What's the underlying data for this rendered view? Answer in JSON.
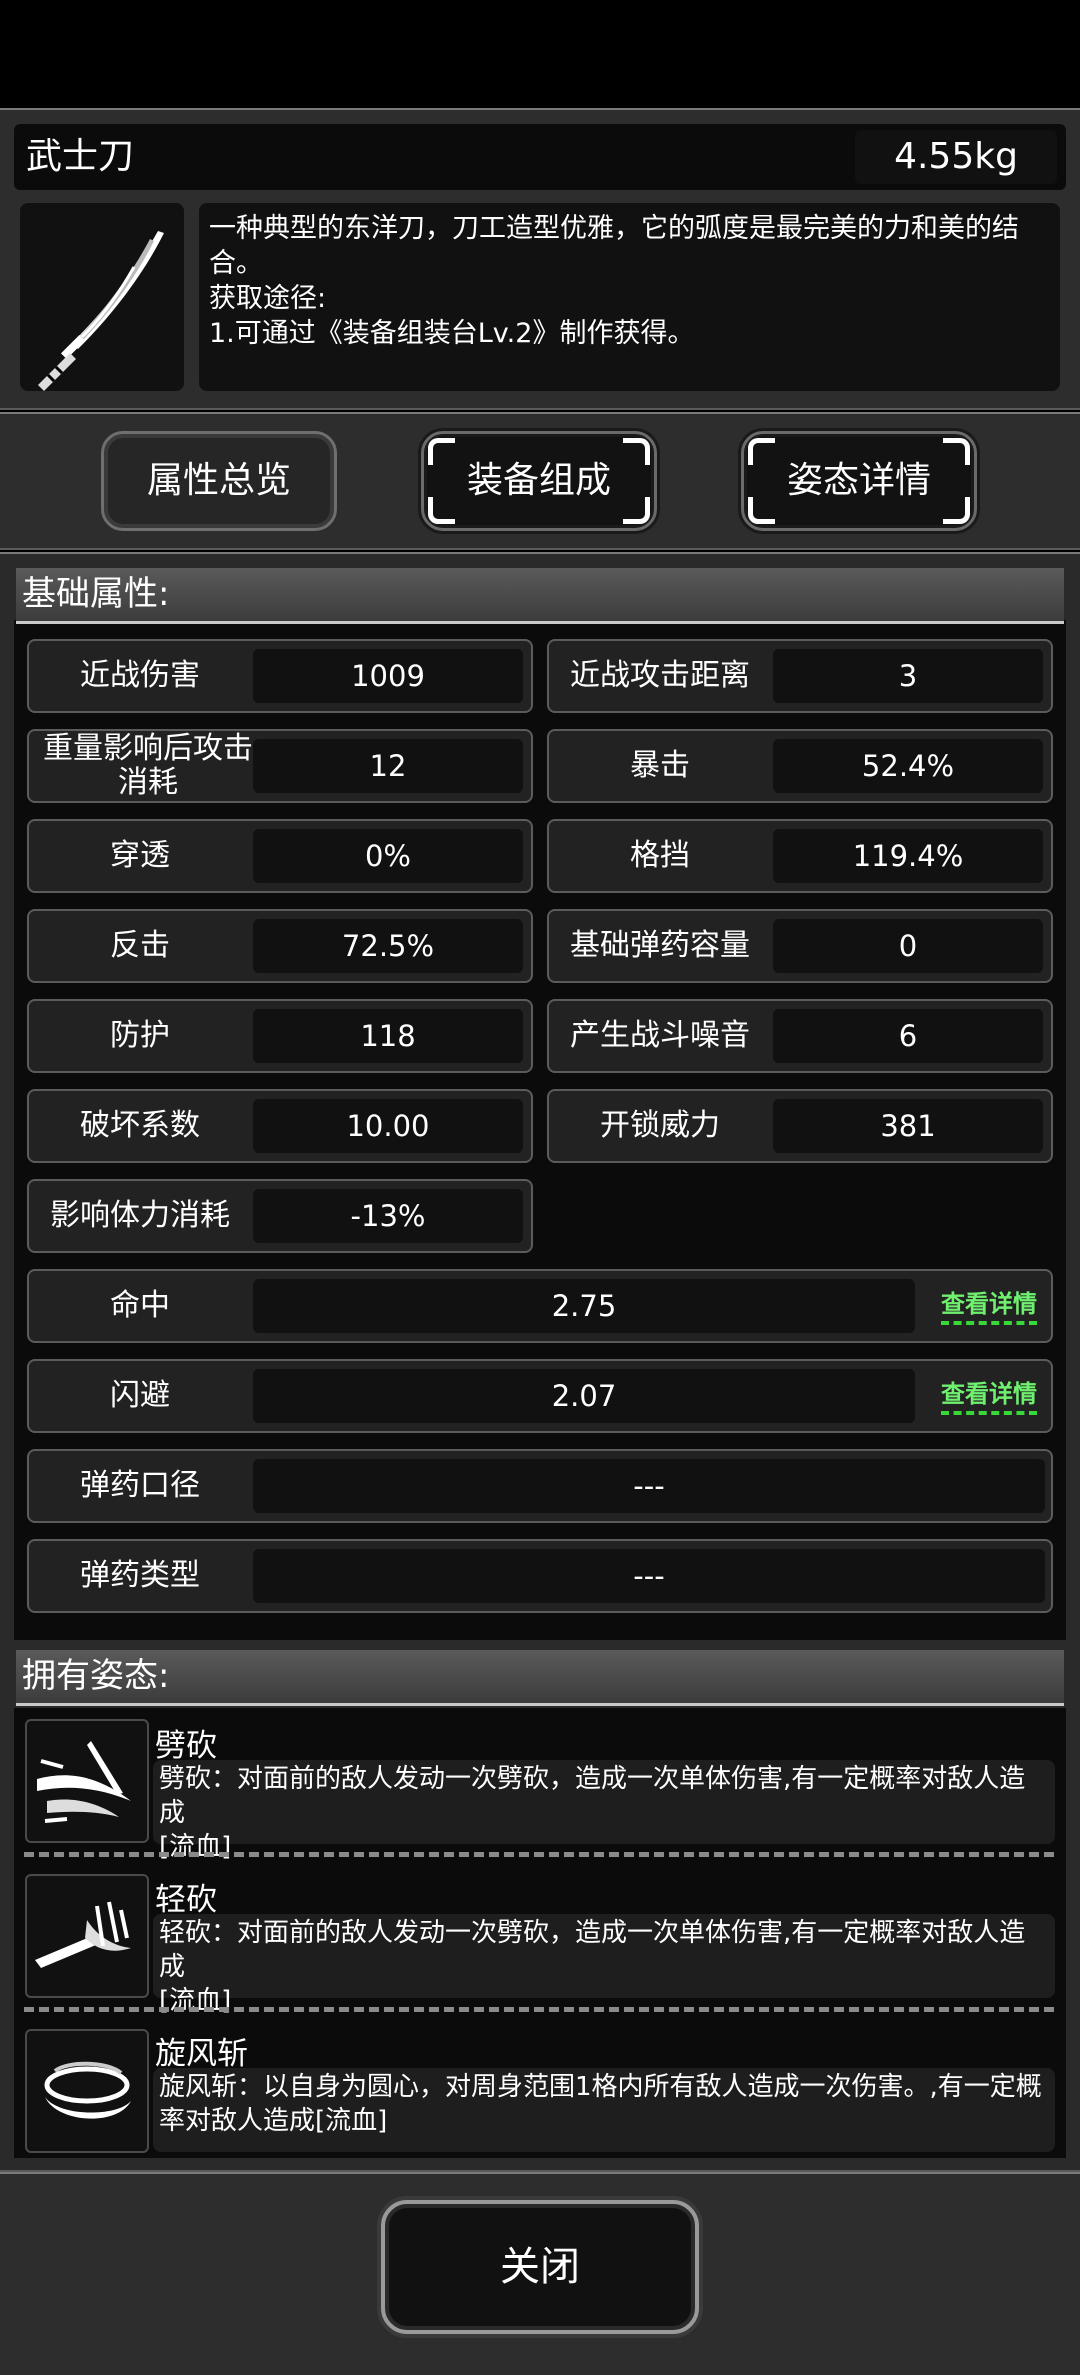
{
  "item": {
    "name": "武士刀",
    "weight": "4.55kg",
    "description": "一种典型的东洋刀，刀工造型优雅，它的弧度是最完美的力和美的结合。\n获取途径:\n1.可通过《装备组装台Lv.2》制作获得。",
    "icon": "katana-icon"
  },
  "tabs": [
    {
      "label": "属性总览",
      "selected": true
    },
    {
      "label": "装备组成",
      "selected": false
    },
    {
      "label": "姿态详情",
      "selected": false
    }
  ],
  "base_section": {
    "title": "基础属性:",
    "pairs": [
      {
        "label": "近战伤害",
        "value": "1009"
      },
      {
        "label": "近战攻击距离",
        "value": "3"
      },
      {
        "label": "重量影响后攻击消耗",
        "value": "12"
      },
      {
        "label": "暴击",
        "value": "52.4%"
      },
      {
        "label": "穿透",
        "value": "0%"
      },
      {
        "label": "格挡",
        "value": "119.4%"
      },
      {
        "label": "反击",
        "value": "72.5%"
      },
      {
        "label": "基础弹药容量",
        "value": "0"
      },
      {
        "label": "防护",
        "value": "118"
      },
      {
        "label": "产生战斗噪音",
        "value": "6"
      },
      {
        "label": "破坏系数",
        "value": "10.00"
      },
      {
        "label": "开锁威力",
        "value": "381"
      },
      {
        "label": "影响体力消耗",
        "value": "-13%"
      }
    ],
    "wide_rows": [
      {
        "label": "命中",
        "value": "2.75",
        "link": "查看详情"
      },
      {
        "label": "闪避",
        "value": "2.07",
        "link": "查看详情"
      },
      {
        "label": "弹药口径",
        "value": "---"
      },
      {
        "label": "弹药类型",
        "value": "---"
      }
    ]
  },
  "stance_section": {
    "title": "拥有姿态:",
    "stances": [
      {
        "name": "劈砍",
        "desc": "劈砍：对面前的敌人发动一次劈砍，造成一次单体伤害,有一定概率对敌人造成\n[流血]",
        "icon": "chop-slash-icon"
      },
      {
        "name": "轻砍",
        "desc": "轻砍：对面前的敌人发动一次劈砍，造成一次单体伤害,有一定概率对敌人造成\n[流血]",
        "icon": "light-slash-icon"
      },
      {
        "name": "旋风斩",
        "desc": "旋风斩：以自身为圆心，对周身范围1格内所有敌人造成一次伤害。,有一定概\n率对敌人造成[流血]",
        "icon": "whirlwind-icon"
      }
    ]
  },
  "close_label": "关闭"
}
